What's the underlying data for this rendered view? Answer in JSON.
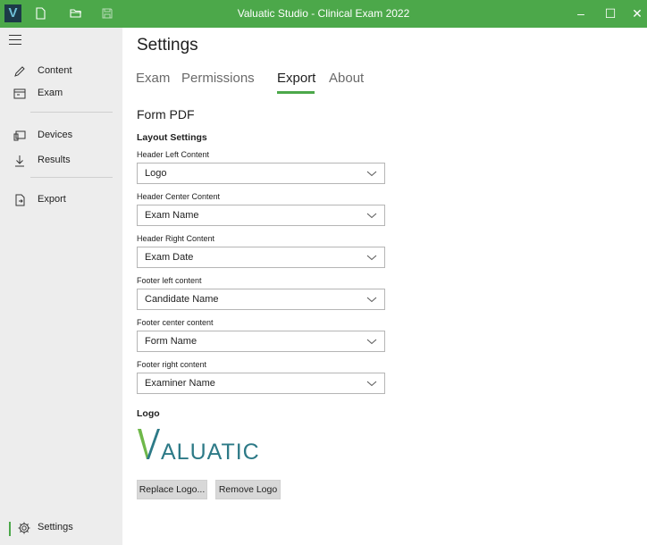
{
  "window": {
    "title": "Valuatic Studio - Clinical Exam 2022",
    "app_icon_letter": "V",
    "controls": {
      "minimize": "–",
      "maximize": "☐",
      "close": "✕"
    },
    "accent": "#4ca84a"
  },
  "toolbar": {
    "icons": [
      "new-file-icon",
      "open-folder-icon",
      "save-icon"
    ]
  },
  "sidebar": {
    "items": [
      {
        "label": "Content",
        "icon": "pencil-icon"
      },
      {
        "label": "Exam",
        "icon": "exam-icon"
      },
      {
        "label": "Devices",
        "icon": "devices-icon"
      },
      {
        "label": "Results",
        "icon": "download-icon"
      },
      {
        "label": "Export",
        "icon": "export-icon"
      },
      {
        "label": "Settings",
        "icon": "gear-icon",
        "active": true
      }
    ]
  },
  "main": {
    "title": "Settings",
    "tabs": [
      {
        "label": "Exam"
      },
      {
        "label": "Permissions"
      },
      {
        "label": "Export",
        "active": true
      },
      {
        "label": "About"
      }
    ],
    "section_title": "Form PDF",
    "group_title": "Layout Settings",
    "fields": [
      {
        "label": "Header Left Content",
        "value": "Logo"
      },
      {
        "label": "Header Center Content",
        "value": "Exam Name"
      },
      {
        "label": "Header Right Content",
        "value": "Exam Date"
      },
      {
        "label": "Footer left content",
        "value": "Candidate Name"
      },
      {
        "label": "Footer center content",
        "value": "Form Name"
      },
      {
        "label": "Footer right content",
        "value": "Examiner Name"
      }
    ],
    "logo": {
      "label": "Logo",
      "brand_text": "VALUATIC",
      "brand_color": "#2d7a87",
      "brand_accent": "#6fb84a"
    },
    "buttons": {
      "replace_logo": "Replace Logo...",
      "remove_logo": "Remove Logo"
    }
  }
}
